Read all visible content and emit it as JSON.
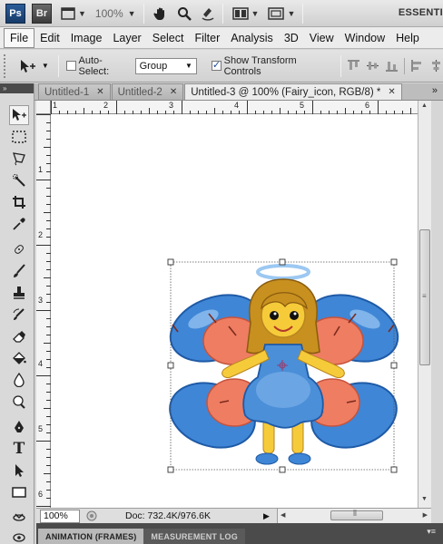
{
  "app_bar": {
    "ps_label": "Ps",
    "br_label": "Br",
    "zoom": "100%",
    "workspace": "ESSENTI"
  },
  "menu": [
    "File",
    "Edit",
    "Image",
    "Layer",
    "Select",
    "Filter",
    "Analysis",
    "3D",
    "View",
    "Window",
    "Help"
  ],
  "options": {
    "auto_select_label": "Auto-Select:",
    "auto_select_checked": false,
    "group_value": "Group",
    "show_transform_label": "Show Transform Controls",
    "show_transform_checked": true
  },
  "tabs": [
    {
      "label": "Untitled-1",
      "active": false
    },
    {
      "label": "Untitled-2",
      "active": false
    },
    {
      "label": "Untitled-3 @ 100% (Fairy_icon, RGB/8) *",
      "active": true
    }
  ],
  "panel_collapse": "»",
  "tools_header": "»",
  "ruler": {
    "h_labels": [
      "1",
      "2",
      "3",
      "4",
      "5",
      "6"
    ],
    "v_labels": [
      "1",
      "2",
      "3",
      "4",
      "5",
      "6"
    ]
  },
  "status": {
    "zoom": "100%",
    "doc": "Doc: 732.4K/976.6K"
  },
  "bottom_tabs": [
    "ANIMATION (FRAMES)",
    "MEASUREMENT LOG"
  ],
  "colors": {
    "wing_blue": "#3f86d6",
    "wing_salmon": "#ee7d62",
    "dress": "#4b8fd8",
    "hair": "#c8901f",
    "skin": "#f6cb3a"
  }
}
